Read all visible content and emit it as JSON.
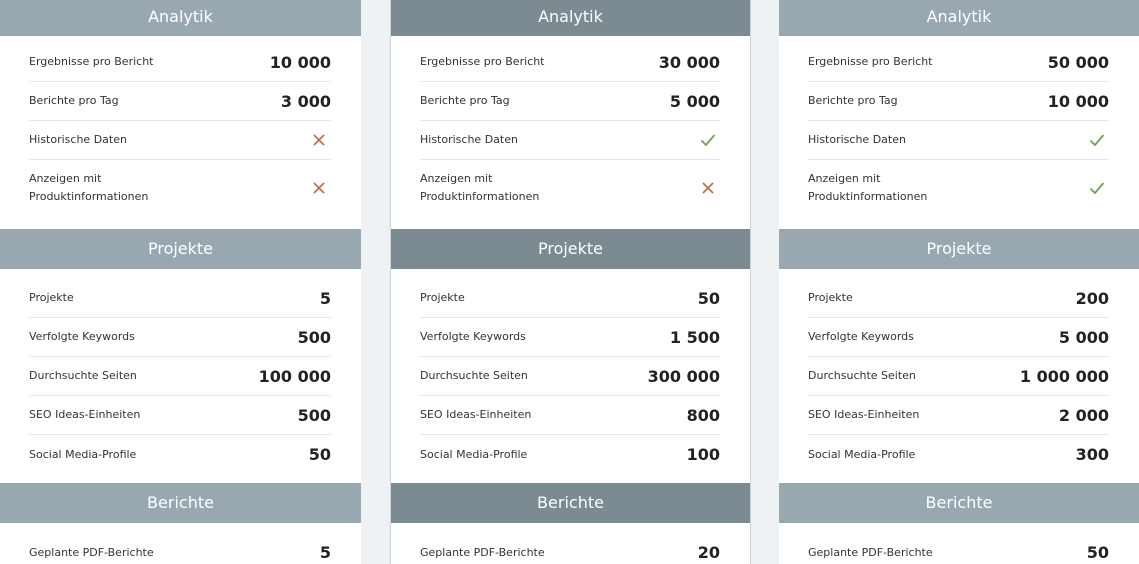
{
  "colors": {
    "header_default": "#99a8b0",
    "header_featured": "#7c8b92",
    "cross": "#c0704a",
    "check": "#6aa84f"
  },
  "plans": [
    {
      "analytik": {
        "title": "Analytik",
        "rows": [
          {
            "label": "Ergebnisse pro Bericht",
            "value": "10 000"
          },
          {
            "label": "Berichte pro Tag",
            "value": "3 000"
          },
          {
            "label": "Historische Daten",
            "icon": "cross-icon"
          },
          {
            "label": "Anzeigen mit Produktinformationen",
            "icon": "cross-icon"
          }
        ]
      },
      "projekte": {
        "title": "Projekte",
        "rows": [
          {
            "label": "Projekte",
            "value": "5"
          },
          {
            "label": "Verfolgte Keywords",
            "value": "500"
          },
          {
            "label": "Durchsuchte Seiten",
            "value": "100 000"
          },
          {
            "label": "SEO Ideas-Einheiten",
            "value": "500"
          },
          {
            "label": "Social Media-Profile",
            "value": "50"
          }
        ]
      },
      "berichte": {
        "title": "Berichte",
        "rows": [
          {
            "label": "Geplante PDF-Berichte",
            "value": "5"
          }
        ]
      }
    },
    {
      "analytik": {
        "title": "Analytik",
        "rows": [
          {
            "label": "Ergebnisse pro Bericht",
            "value": "30 000"
          },
          {
            "label": "Berichte pro Tag",
            "value": "5 000"
          },
          {
            "label": "Historische Daten",
            "icon": "check-icon"
          },
          {
            "label": "Anzeigen mit Produktinformationen",
            "icon": "cross-icon"
          }
        ]
      },
      "projekte": {
        "title": "Projekte",
        "rows": [
          {
            "label": "Projekte",
            "value": "50"
          },
          {
            "label": "Verfolgte Keywords",
            "value": "1 500"
          },
          {
            "label": "Durchsuchte Seiten",
            "value": "300 000"
          },
          {
            "label": "SEO Ideas-Einheiten",
            "value": "800"
          },
          {
            "label": "Social Media-Profile",
            "value": "100"
          }
        ]
      },
      "berichte": {
        "title": "Berichte",
        "rows": [
          {
            "label": "Geplante PDF-Berichte",
            "value": "20"
          }
        ]
      }
    },
    {
      "analytik": {
        "title": "Analytik",
        "rows": [
          {
            "label": "Ergebnisse pro Bericht",
            "value": "50 000"
          },
          {
            "label": "Berichte pro Tag",
            "value": "10 000"
          },
          {
            "label": "Historische Daten",
            "icon": "check-icon"
          },
          {
            "label": "Anzeigen mit Produktinformationen",
            "icon": "check-icon"
          }
        ]
      },
      "projekte": {
        "title": "Projekte",
        "rows": [
          {
            "label": "Projekte",
            "value": "200"
          },
          {
            "label": "Verfolgte Keywords",
            "value": "5 000"
          },
          {
            "label": "Durchsuchte Seiten",
            "value": "1 000 000"
          },
          {
            "label": "SEO Ideas-Einheiten",
            "value": "2 000"
          },
          {
            "label": "Social Media-Profile",
            "value": "300"
          }
        ]
      },
      "berichte": {
        "title": "Berichte",
        "rows": [
          {
            "label": "Geplante PDF-Berichte",
            "value": "50"
          }
        ]
      }
    }
  ]
}
